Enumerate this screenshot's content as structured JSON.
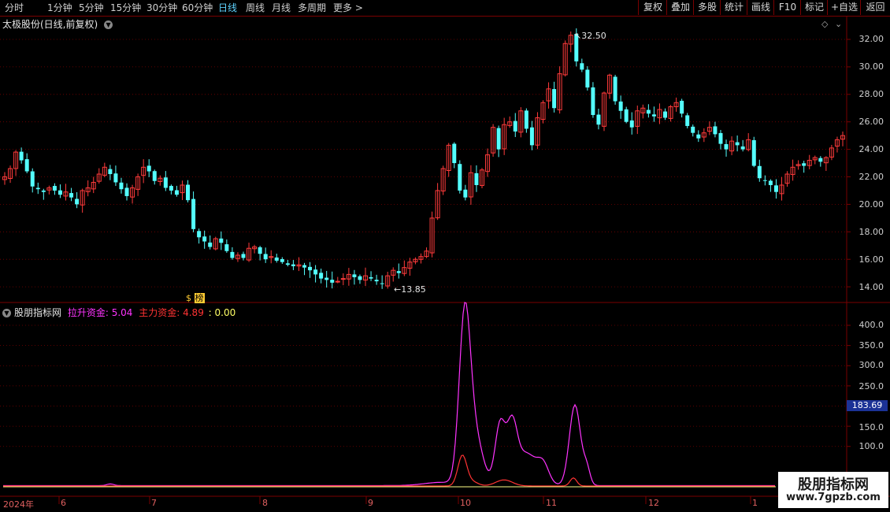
{
  "toolbar": {
    "periods": [
      "分时",
      "1分钟",
      "5分钟",
      "15分钟",
      "30分钟",
      "60分钟",
      "日线",
      "周线",
      "月线",
      "多周期",
      "更多 >"
    ],
    "active_index": 6,
    "right_buttons": [
      "复权",
      "叠加",
      "多股",
      "统计",
      "画线",
      "F10",
      "标记",
      "+自选",
      "返回"
    ]
  },
  "main_chart": {
    "title": "太极股份(日线,前复权)",
    "y_ticks": [
      "32.00",
      "30.00",
      "28.00",
      "26.00",
      "24.00",
      "22.00",
      "20.00",
      "18.00",
      "16.00",
      "14.00"
    ],
    "high_label": "32.50",
    "low_label": "13.85",
    "marker_text": "$",
    "marker_badge": "榜"
  },
  "indicator": {
    "name": "股朋指标网",
    "series1_label": "拉升资金: ",
    "series1_value": "5.04",
    "series2_label": "主力资金: ",
    "series2_value": "4.89",
    "series3_value": ": 0.00",
    "y_ticks": [
      "400.0",
      "350.0",
      "300.0",
      "250.0",
      "150.0",
      "100.0"
    ],
    "current_value": "183.69"
  },
  "x_axis": [
    "2024年",
    "6",
    "7",
    "8",
    "9",
    "10",
    "11",
    "12",
    "1"
  ],
  "watermark": {
    "line1": "股朋指标网",
    "line2": "www.7gpzb.com"
  },
  "colors": {
    "up": "#ff3b3b",
    "down": "#54ffff",
    "magenta": "#ff33ff",
    "red_line": "#ff3333",
    "grid": "#7a0000"
  },
  "chart_data": {
    "type": "candlestick",
    "closes": [
      22.0,
      22.6,
      23.8,
      23.2,
      22.4,
      21.3,
      21.1,
      20.9,
      21.2,
      21.0,
      20.7,
      20.9,
      20.5,
      20.0,
      21.0,
      21.2,
      21.6,
      22.2,
      22.7,
      22.2,
      21.6,
      21.1,
      20.6,
      21.2,
      22.0,
      22.7,
      22.4,
      21.7,
      21.9,
      21.2,
      21.0,
      20.7,
      21.4,
      20.3,
      18.2,
      17.6,
      17.3,
      16.9,
      17.5,
      17.2,
      16.6,
      16.1,
      16.3,
      16.1,
      16.8,
      16.9,
      16.4,
      16.0,
      16.2,
      15.9,
      15.8,
      15.6,
      15.5,
      15.6,
      15.4,
      15.2,
      14.9,
      14.6,
      14.5,
      14.3,
      14.4,
      14.6,
      14.9,
      14.7,
      14.5,
      14.8,
      14.6,
      14.4,
      14.2,
      14.8,
      15.2,
      15.0,
      15.4,
      15.8,
      16.0,
      16.2,
      16.6,
      19.0,
      21.0,
      22.6,
      24.3,
      23.0,
      21.0,
      20.5,
      22.3,
      21.4,
      22.5,
      23.6,
      25.6,
      24.0,
      25.8,
      26.0,
      25.3,
      26.8,
      25.5,
      24.3,
      26.3,
      27.4,
      28.4,
      27.0,
      29.5,
      31.7,
      32.3,
      30.4,
      29.8,
      28.5,
      26.5,
      25.8,
      28.1,
      29.4,
      27.5,
      26.8,
      26.0,
      25.6,
      26.8,
      27.0,
      26.6,
      26.4,
      26.9,
      26.3,
      27.1,
      27.4,
      26.6,
      25.7,
      25.2,
      24.8,
      25.2,
      25.6,
      25.1,
      24.4,
      24.0,
      24.6,
      24.3,
      24.0,
      24.7,
      22.8,
      21.9,
      21.7,
      21.4,
      20.9,
      21.4,
      22.2,
      22.7,
      22.9,
      22.8,
      23.2,
      23.4,
      23.1,
      23.4,
      24.1,
      24.7,
      25.0
    ]
  }
}
